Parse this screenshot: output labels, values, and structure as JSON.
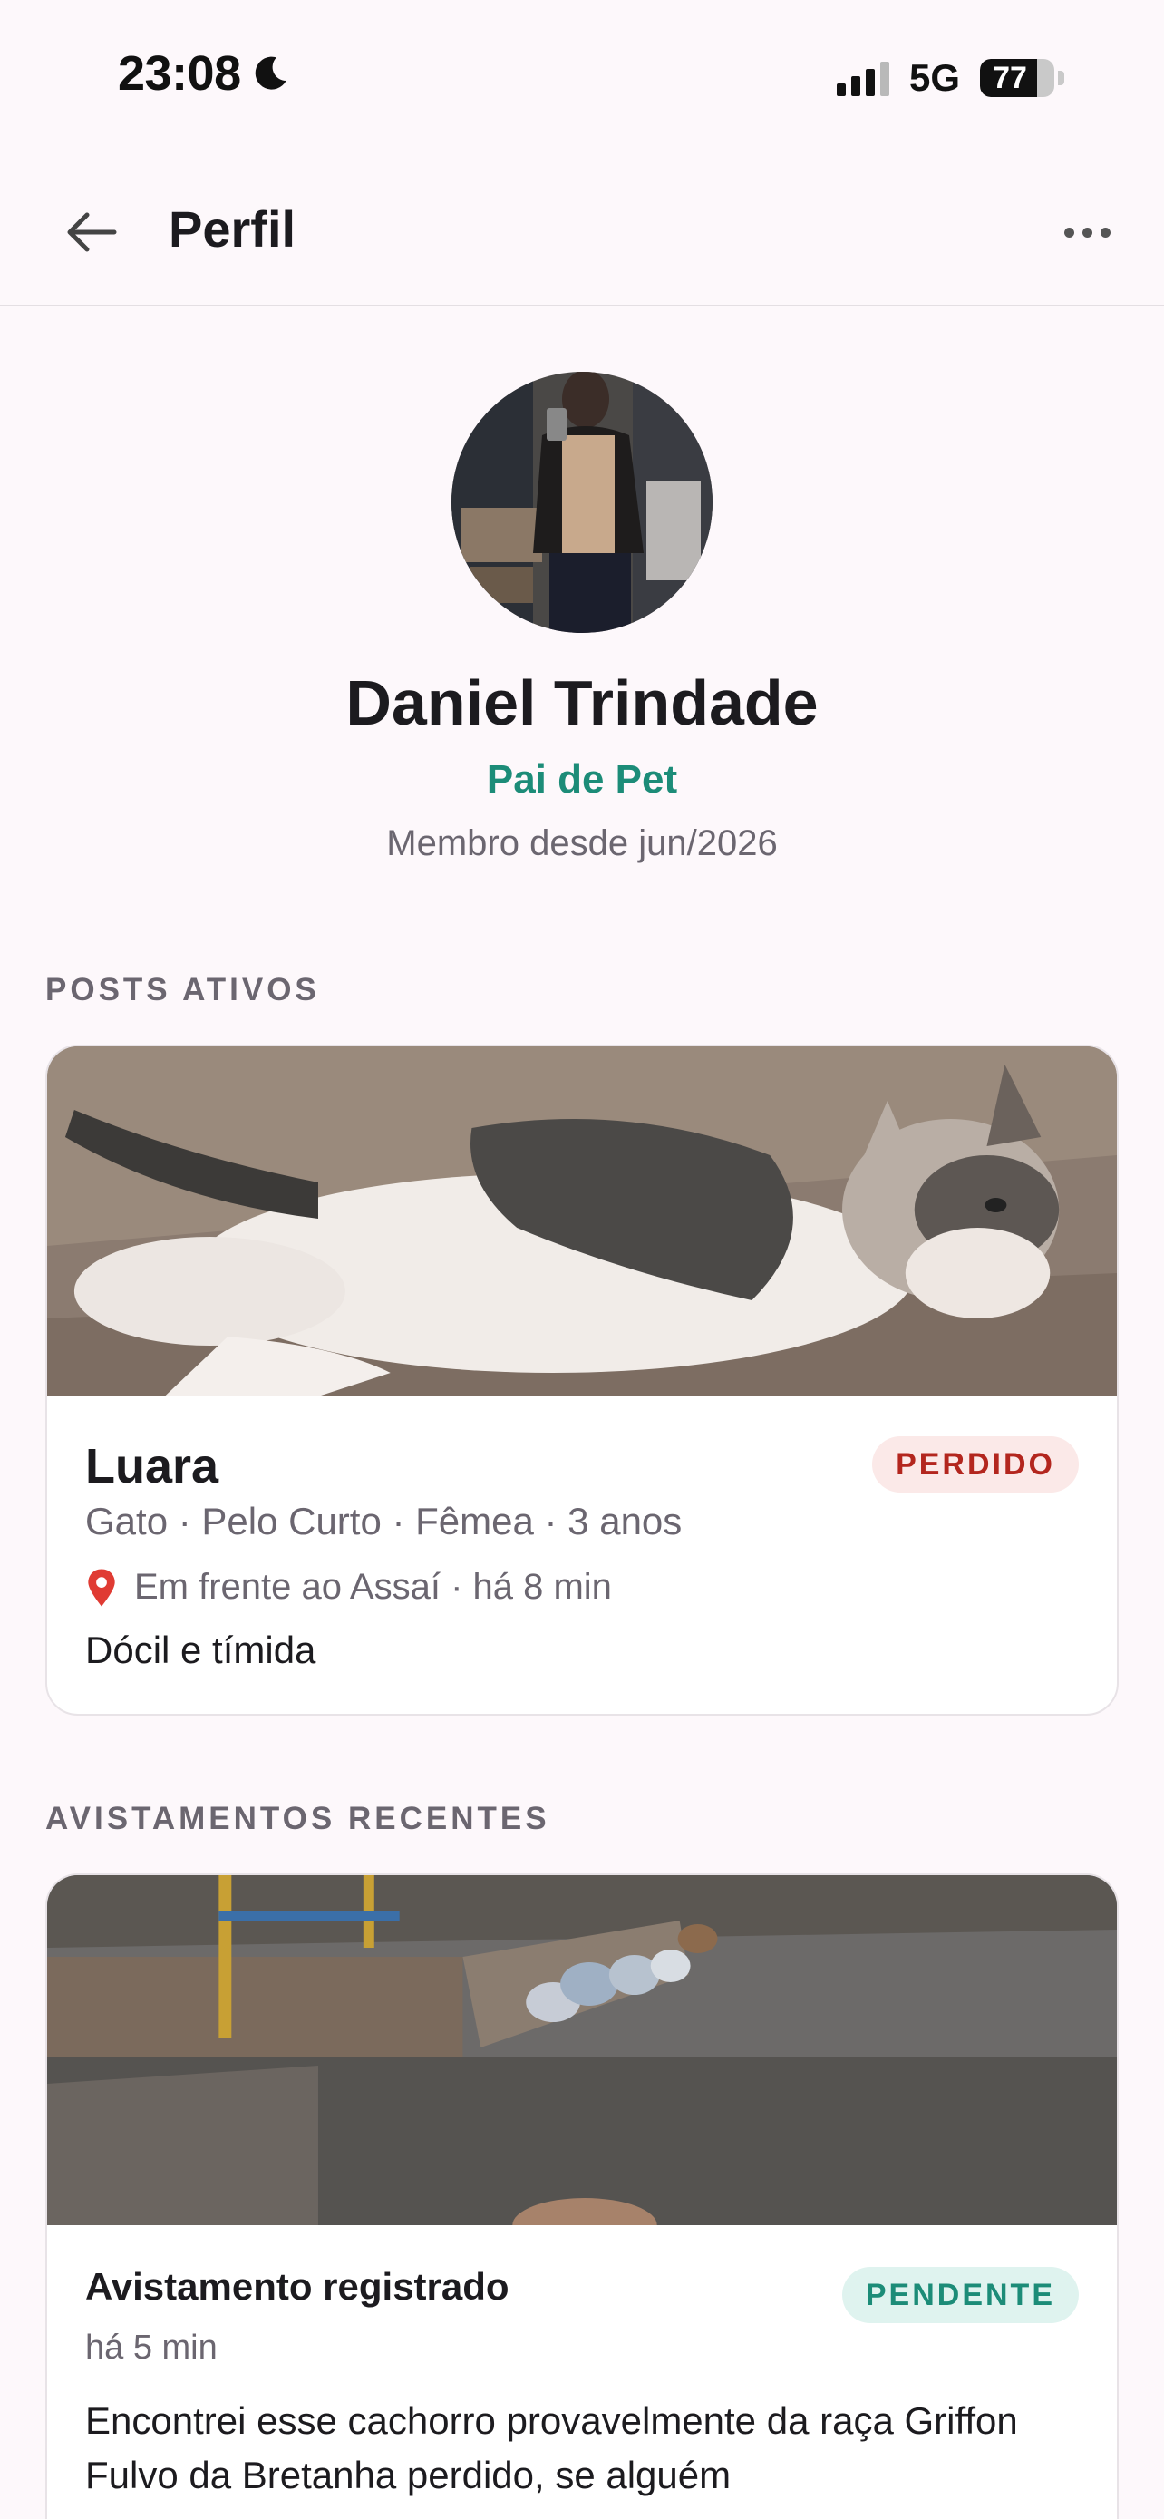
{
  "status_bar": {
    "time": "23:08",
    "network": "5G",
    "battery": "77",
    "battery_level": 0.77
  },
  "app_bar": {
    "title": "Perfil"
  },
  "profile": {
    "name": "Daniel Trindade",
    "role": "Pai de Pet",
    "member_since": "Membro desde jun/2026"
  },
  "sections": {
    "active_posts": "POSTS ATIVOS",
    "recent_sightings": "AVISTAMENTOS RECENTES"
  },
  "post": {
    "pet_name": "Luara",
    "status": "PERDIDO",
    "meta": "Gato · Pelo Curto · Fêmea · 3 anos",
    "location": "Em frente ao Assaí · há 8 min",
    "description": "Dócil e tímida"
  },
  "sighting": {
    "title": "Avistamento registrado",
    "status": "PENDENTE",
    "time": "há 5 min",
    "description": "Encontrei esse cachorro provavelmente da raça Griffon Fulvo da Bretanha perdido, se alguém"
  },
  "colors": {
    "accent": "#1c8c78",
    "lost": "#b3261e",
    "lost_bg": "#fbe9e8",
    "pending_bg": "#dff3ef",
    "background": "#fdf8fb"
  },
  "icons": [
    "moon-icon",
    "signal-icon",
    "battery-icon",
    "back-arrow-icon",
    "more-icon",
    "location-pin-icon"
  ]
}
